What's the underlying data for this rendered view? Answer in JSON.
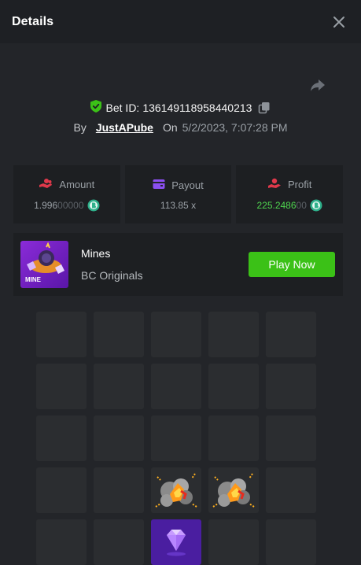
{
  "header": {
    "title": "Details"
  },
  "bet": {
    "label": "Bet ID:",
    "id": "136149118958440213",
    "by_label": "By",
    "user": "JustAPube",
    "on_label": "On",
    "datetime": "5/2/2023, 7:07:28 PM"
  },
  "stats": {
    "amount": {
      "label": "Amount",
      "value_main": "1.996",
      "value_dim": "00000"
    },
    "payout": {
      "label": "Payout",
      "value": "113.85 x"
    },
    "profit": {
      "label": "Profit",
      "value_main": "225.2486",
      "value_dim": "00"
    }
  },
  "game": {
    "name": "Mines",
    "provider": "BC Originals",
    "thumb_label": "MINE",
    "play_label": "Play Now"
  },
  "board": {
    "columns": 5,
    "visible_rows": 5,
    "tiles": [
      "hidden",
      "hidden",
      "hidden",
      "hidden",
      "hidden",
      "hidden",
      "hidden",
      "hidden",
      "hidden",
      "hidden",
      "hidden",
      "hidden",
      "hidden",
      "hidden",
      "hidden",
      "hidden",
      "hidden",
      "mine",
      "mine",
      "hidden",
      "hidden",
      "hidden",
      "gem",
      "hidden",
      "hidden"
    ]
  },
  "colors": {
    "background": "#232529",
    "panel": "#1d1f22",
    "accent_green": "#3bc117",
    "profit_green": "#4fd44f",
    "gem_purple": "#4a1ea0"
  },
  "icons": {
    "close": "close-icon",
    "share": "share-icon",
    "verified": "shield-check-icon",
    "copy": "copy-icon",
    "amount": "coins-hand-icon",
    "payout": "wallet-icon",
    "profit": "profit-hand-icon",
    "coin": "bcd-coin-icon"
  }
}
